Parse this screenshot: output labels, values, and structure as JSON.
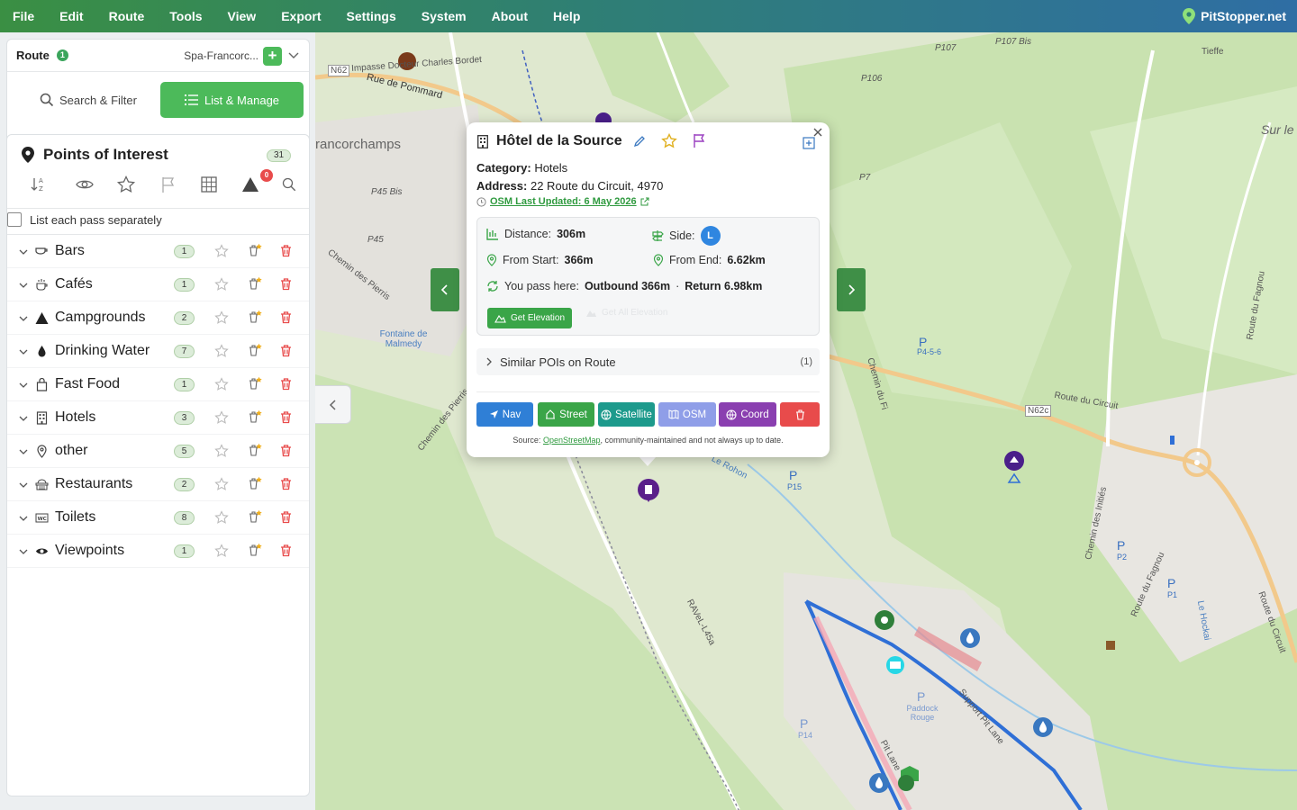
{
  "menu": [
    "File",
    "Edit",
    "Route",
    "Tools",
    "View",
    "Export",
    "Settings",
    "System",
    "About",
    "Help"
  ],
  "brand": "PitStopper.net",
  "route": {
    "label": "Route",
    "badge": "1",
    "name": "Spa-Francorc..."
  },
  "tabs": {
    "search": "Search & Filter",
    "list": "List & Manage"
  },
  "poi": {
    "title": "Points of Interest",
    "count": "31",
    "hazard_badge": "0",
    "pass_label": "List each pass separately",
    "categories": [
      {
        "name": "Bars",
        "count": "1",
        "icon": "cup-icon"
      },
      {
        "name": "Cafés",
        "count": "1",
        "icon": "coffee-icon"
      },
      {
        "name": "Campgrounds",
        "count": "2",
        "icon": "tent-icon"
      },
      {
        "name": "Drinking Water",
        "count": "7",
        "icon": "water-drop-icon"
      },
      {
        "name": "Fast Food",
        "count": "1",
        "icon": "bag-icon"
      },
      {
        "name": "Hotels",
        "count": "3",
        "icon": "building-icon"
      },
      {
        "name": "other",
        "count": "5",
        "icon": "pin-icon"
      },
      {
        "name": "Restaurants",
        "count": "2",
        "icon": "restaurant-icon"
      },
      {
        "name": "Toilets",
        "count": "8",
        "icon": "wc-icon"
      },
      {
        "name": "Viewpoints",
        "count": "1",
        "icon": "eye-icon"
      }
    ]
  },
  "map_labels": {
    "n62": "N62",
    "n62c": "N62c",
    "impasse": "Impasse Docteur Charles Bordet",
    "pommard": "Rue de Pommard",
    "francorchamps": "rancorchamps",
    "p45bis": "P45 Bis",
    "p45": "P45",
    "pierris": "Chemin des Pierris",
    "pierris2": "Chemin des Pierris",
    "fontaine": "Fontaine de Malmedy",
    "p107bis": "P107 Bis",
    "p107": "P107",
    "p106": "P106",
    "p7": "P7",
    "tieffe": "Tieffe",
    "surle": "Sur le",
    "p456": "P4-5-6",
    "route_circuit": "Route du Circuit",
    "route_circuit2": "Route du Circuit",
    "p15": "P15",
    "p2": "P2",
    "p1": "P1",
    "p14": "P14",
    "paddock": "Paddock Rouge",
    "pitlane": "Pit Lane",
    "support_pitlane": "Support Pit Lane",
    "chemin_fi": "Chemin du Fi",
    "chemin_inities": "Chemin des Initiés",
    "fagnou": "Route du Fagnou",
    "rohon": "Le Rohon",
    "hockai": "Le Hockai",
    "ravel": "RAVeL-L45a"
  },
  "popup": {
    "title": "Hôtel de la Source",
    "category_label": "Category:",
    "category": "Hotels",
    "address_label": "Address:",
    "address": "22 Route du Circuit, 4970",
    "osm": "OSM Last Updated: 6 May 2026",
    "distance_label": "Distance:",
    "distance": "306m",
    "side_label": "Side:",
    "side": "L",
    "from_start_label": "From Start:",
    "from_start": "366m",
    "from_end_label": "From End:",
    "from_end": "6.62km",
    "pass_label": "You pass here:",
    "pass_out": "Outbound 366m",
    "pass_sep": "·",
    "pass_return": "Return 6.98km",
    "get_elevation": "Get Elevation",
    "get_all_elevation": "Get All Elevation",
    "similar": "Similar POIs on Route",
    "similar_count": "(1)",
    "buttons": {
      "nav": "Nav",
      "street": "Street",
      "satellite": "Satellite",
      "osm": "OSM",
      "coord": "Coord"
    },
    "source_prefix": "Source:",
    "source_link": "OpenStreetMap",
    "source_suffix": ", community-maintained and not always up to date."
  },
  "colors": {
    "green": "#4cba5a",
    "nav_blue": "#2f7fd6",
    "satellite_teal": "#1d9a8c",
    "osm_lavender": "#8f9ee8",
    "coord_purple": "#8a3fb0",
    "delete_red": "#e84b4b"
  }
}
